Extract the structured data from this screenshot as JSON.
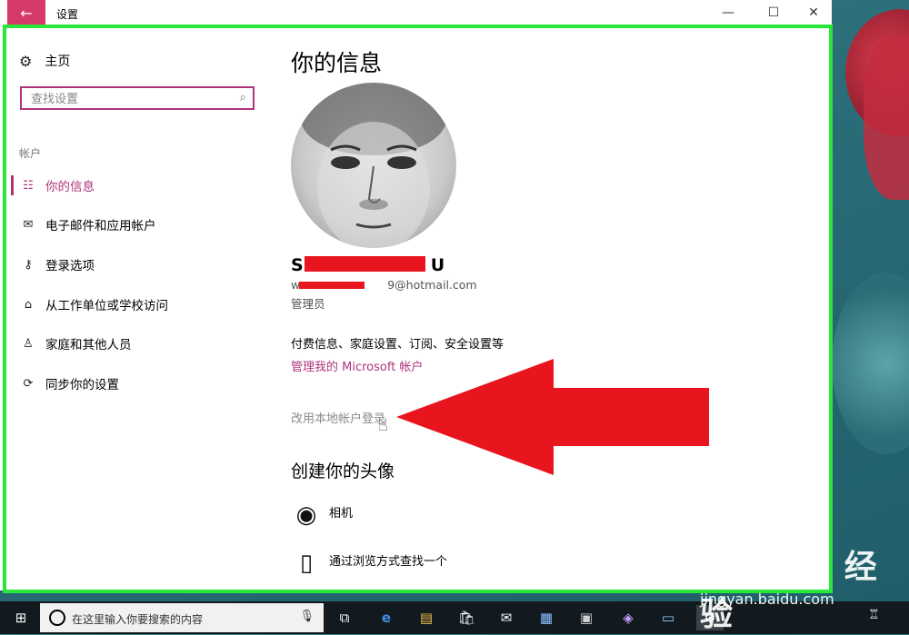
{
  "window": {
    "title": "设置",
    "back_icon": "←",
    "minimize_icon": "—",
    "maximize_icon": "☐",
    "close_icon": "✕"
  },
  "sidebar": {
    "home_icon": "⚙",
    "home_label": "主页",
    "search_placeholder": "查找设置",
    "search_icon": "⌕",
    "section_label": "帐户",
    "items": [
      {
        "icon": "☷",
        "label": "你的信息"
      },
      {
        "icon": "✉",
        "label": "电子邮件和应用帐户"
      },
      {
        "icon": "⚷",
        "label": "登录选项"
      },
      {
        "icon": "⌂",
        "label": "从工作单位或学校访问"
      },
      {
        "icon": "♙",
        "label": "家庭和其他人员"
      },
      {
        "icon": "⟳",
        "label": "同步你的设置"
      }
    ]
  },
  "main": {
    "title": "你的信息",
    "user_name_first": "S",
    "user_name_last": "U",
    "user_email_prefix": "w",
    "user_email_suffix": "9@hotmail.com",
    "role": "管理员",
    "billing_text": "付费信息、家庭设置、订阅、安全设置等",
    "manage_link": "管理我的 Microsoft 帐户",
    "local_link": "改用本地帐户登录",
    "create_avatar_title": "创建你的头像",
    "avatar_options": [
      {
        "icon": "◉",
        "label": "相机"
      },
      {
        "icon": "▯",
        "label": "通过浏览方式查找一个"
      }
    ]
  },
  "taskbar": {
    "start_icon": "⊞",
    "search_text": "在这里输入你要搜索的内容",
    "mic_icon": "🎙",
    "icons": [
      "⧉",
      "e",
      "▤",
      "🛍",
      "✉",
      "▦",
      "▣",
      "◈",
      "▭",
      "⚙"
    ],
    "tray_icon": "♖"
  },
  "watermark": {
    "logo": "Bai⟡du 经验",
    "url": "jingyan.baidu.com"
  },
  "colors": {
    "accent": "#b0327a",
    "back_button": "#d53a6a",
    "green_frame": "#29e63a",
    "redaction": "#e8141e",
    "arrow": "#e8141e"
  }
}
